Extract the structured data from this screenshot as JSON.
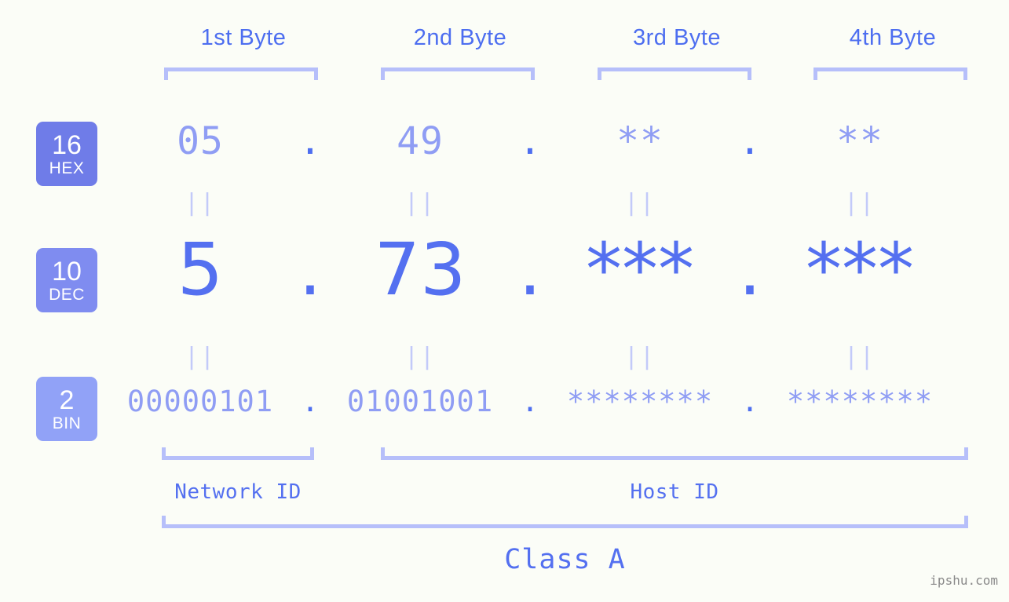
{
  "watermark": "ipshu.com",
  "header": {
    "bytes": [
      {
        "label": "1st Byte"
      },
      {
        "label": "2nd Byte"
      },
      {
        "label": "3rd Byte"
      },
      {
        "label": "4th Byte"
      }
    ]
  },
  "bases": [
    {
      "num": "16",
      "abbr": "HEX"
    },
    {
      "num": "10",
      "abbr": "DEC"
    },
    {
      "num": "2",
      "abbr": "BIN"
    }
  ],
  "rows": {
    "hex": {
      "octets": [
        "05",
        "49",
        "**",
        "**"
      ],
      "separators": [
        ".",
        ".",
        "."
      ]
    },
    "dec": {
      "octets": [
        "5",
        "73",
        "***",
        "***"
      ],
      "separators": [
        ".",
        ".",
        "."
      ]
    },
    "bin": {
      "octets": [
        "00000101",
        "01001001",
        "********",
        "********"
      ],
      "separators": [
        ".",
        ".",
        "."
      ]
    }
  },
  "equality": {
    "mark": "||",
    "hex_dec": [
      "||",
      "||",
      "||",
      "||"
    ],
    "dec_bin": [
      "||",
      "||",
      "||",
      "||"
    ]
  },
  "footer": {
    "network_id": "Network ID",
    "host_id": "Host ID",
    "class": "Class A"
  },
  "colors": {
    "background": "#fbfdf7",
    "accent_strong": "#5470f0",
    "accent_mid": "#8f9df4",
    "accent_light": "#b6bffa",
    "badge_hex": "#6f7ce8",
    "badge_dec": "#7f8cf0",
    "badge_bin": "#91a2f7",
    "watermark": "#8a8a8a"
  }
}
